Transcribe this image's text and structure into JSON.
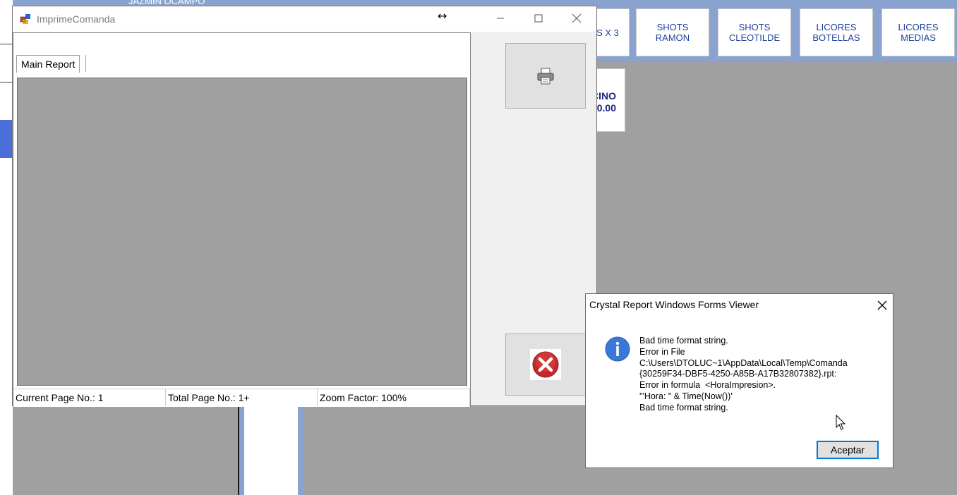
{
  "background_app": {
    "header_name": "JAZMIN OCAMPO",
    "categories": [
      {
        "label": "S X 3"
      },
      {
        "label": "SHOTS\nRAMON"
      },
      {
        "label": "SHOTS\nCLEOTILDE"
      },
      {
        "label": "LICORES\nBOTELLAS"
      },
      {
        "label": "LICORES\nMEDIAS"
      }
    ],
    "product": {
      "name": "CINO",
      "price": "0.00"
    }
  },
  "window": {
    "title": "ImprimeComanda",
    "minimize_icon": "minimize-icon",
    "maximize_icon": "maximize-icon",
    "close_icon": "close-icon",
    "tab_label": "Main Report",
    "status": {
      "current_page": "Current Page No.: 1",
      "total_pages": "Total Page No.: 1+",
      "zoom": "Zoom Factor: 100%"
    },
    "print_button_icon": "printer-icon",
    "cancel_button_icon": "cancel-icon"
  },
  "dialog": {
    "title": "Crystal Report Windows Forms Viewer",
    "icon": "info-icon",
    "message_lines": [
      "Bad time format string.",
      "Error in File",
      "C:\\Users\\DTOLUC~1\\AppData\\Local\\Temp\\Comanda",
      "{30259F34-DBF5-4250-A85B-A17B32807382}.rpt:",
      "Error in formula  <HoraImpresion>.",
      "'\"Hora: \" & Time(Now())'",
      "Bad time format string."
    ],
    "ok_label": "Aceptar"
  },
  "colors": {
    "accent_blue": "#8aa2cf",
    "selection_blue": "#4a6fd8",
    "category_text": "#1f3fa0",
    "dialog_border": "#1979ca"
  }
}
